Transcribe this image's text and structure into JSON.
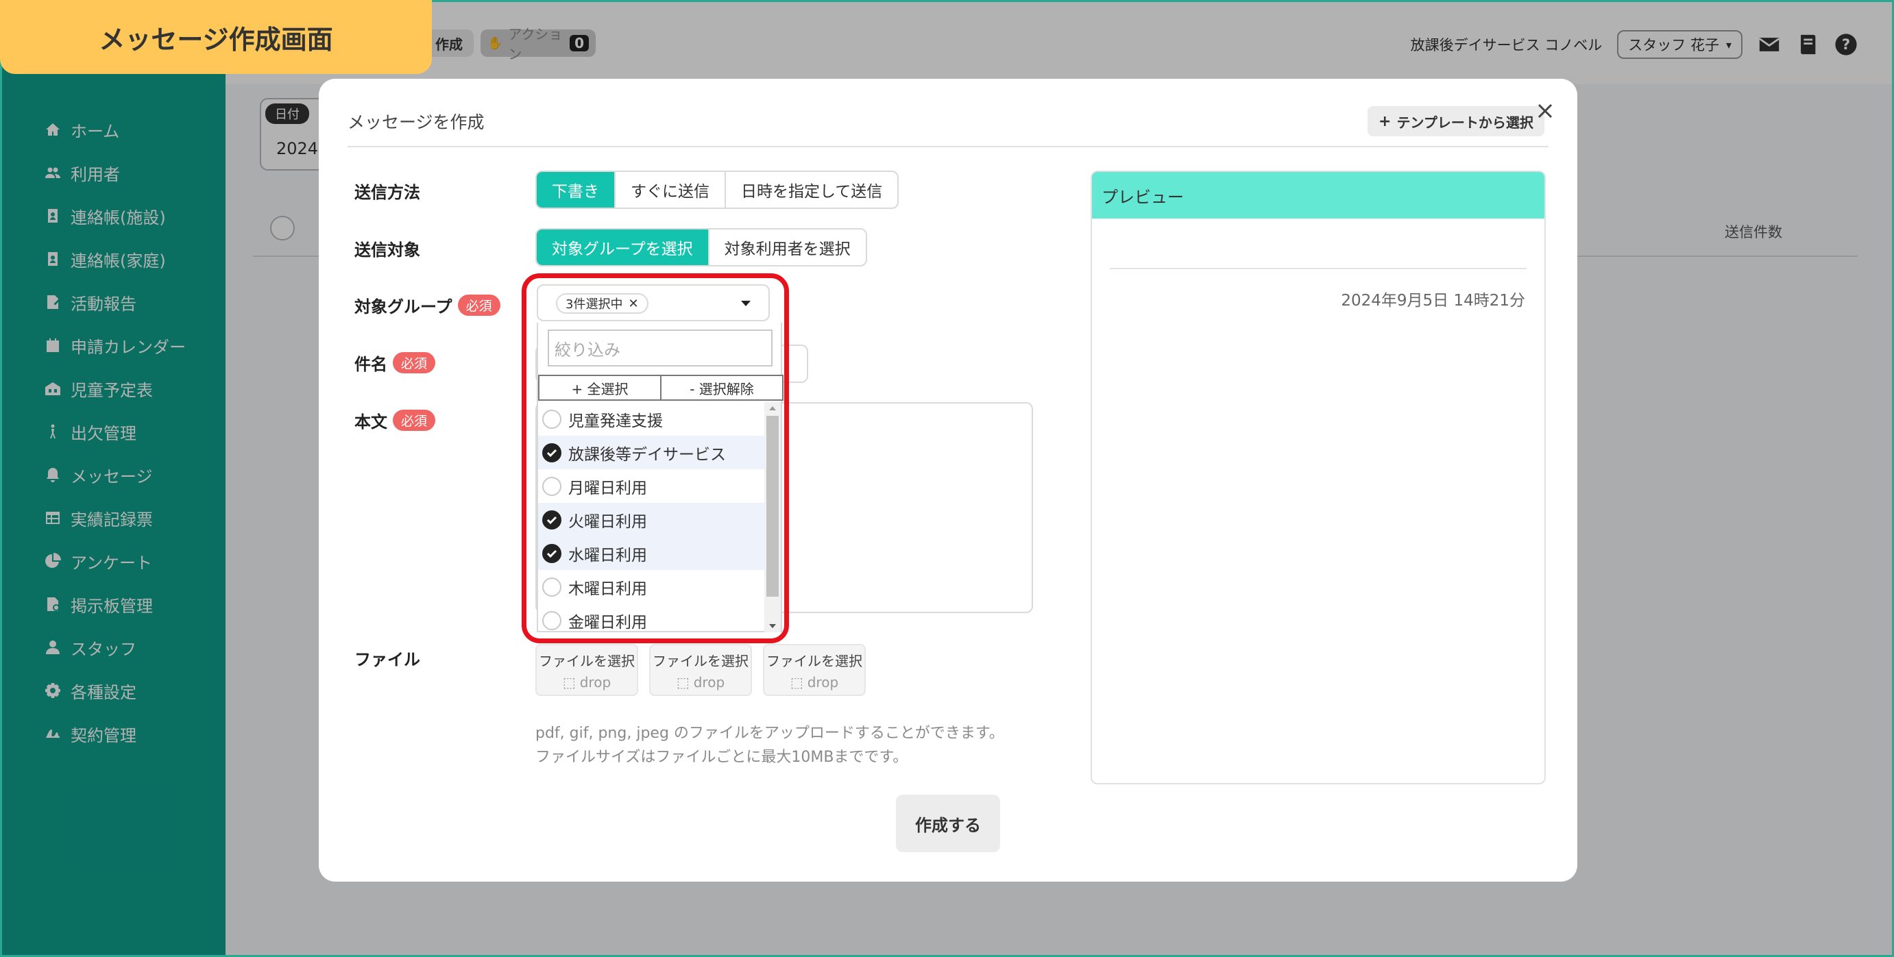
{
  "banner": {
    "title": "メッセージ作成画面"
  },
  "sidebar": {
    "items": [
      {
        "label": "ホーム",
        "icon": "home-icon"
      },
      {
        "label": "利用者",
        "icon": "users-icon"
      },
      {
        "label": "連絡帳(施設)",
        "icon": "contact-book-icon"
      },
      {
        "label": "連絡帳(家庭)",
        "icon": "contact-book-icon"
      },
      {
        "label": "活動報告",
        "icon": "report-icon"
      },
      {
        "label": "申請カレンダー",
        "icon": "calendar-icon"
      },
      {
        "label": "児童予定表",
        "icon": "schedule-icon"
      },
      {
        "label": "出欠管理",
        "icon": "attendance-icon"
      },
      {
        "label": "メッセージ",
        "icon": "bell-icon"
      },
      {
        "label": "実績記録票",
        "icon": "table-icon"
      },
      {
        "label": "アンケート",
        "icon": "pie-chart-icon"
      },
      {
        "label": "掲示板管理",
        "icon": "board-icon"
      },
      {
        "label": "スタッフ",
        "icon": "staff-icon"
      },
      {
        "label": "各種設定",
        "icon": "gear-icon"
      },
      {
        "label": "契約管理",
        "icon": "contract-icon"
      }
    ]
  },
  "header": {
    "create_chip": "作成",
    "action_chip": "アクション",
    "action_count": "0",
    "facility": "放課後デイサービス コノベル",
    "staff": "スタッフ 花子"
  },
  "page": {
    "date_tag": "日付",
    "date_value": "2024,",
    "sent_count_header": "送信件数"
  },
  "modal": {
    "title": "メッセージを作成",
    "template_button": "テンプレートから選択",
    "send_method": {
      "label": "送信方法",
      "options": [
        "下書き",
        "すぐに送信",
        "日時を指定して送信"
      ],
      "selected": "下書き"
    },
    "send_target": {
      "label": "送信対象",
      "options": [
        "対象グループを選択",
        "対象利用者を選択"
      ],
      "selected": "対象グループを選択"
    },
    "target_group": {
      "label": "対象グループ",
      "required": "必須",
      "chip": "3件選択中",
      "filter_placeholder": "絞り込み",
      "select_all": "+ 全選択",
      "deselect": "- 選択解除",
      "options": [
        {
          "label": "児童発達支援",
          "selected": false
        },
        {
          "label": "放課後等デイサービス",
          "selected": true
        },
        {
          "label": "月曜日利用",
          "selected": false
        },
        {
          "label": "火曜日利用",
          "selected": true
        },
        {
          "label": "水曜日利用",
          "selected": true
        },
        {
          "label": "木曜日利用",
          "selected": false
        },
        {
          "label": "金曜日利用",
          "selected": false
        }
      ]
    },
    "subject": {
      "label": "件名",
      "required": "必須"
    },
    "body": {
      "label": "本文",
      "required": "必須"
    },
    "file": {
      "label": "ファイル",
      "select_label": "ファイルを選択",
      "drop_label": "drop",
      "help_line1": "pdf, gif, png, jpeg のファイルをアップロードすることができます。",
      "help_line2": "ファイルサイズはファイルごとに最大10MBまでです。"
    },
    "create_button": "作成する",
    "preview": {
      "title": "プレビュー",
      "date": "2024年9月5日 14時21分"
    }
  },
  "colors": {
    "sidebar": "#0f9e8c",
    "accent": "#14c3ad",
    "preview_header": "#62e8d3",
    "required_badge": "#f06464",
    "banner": "#ffc658",
    "highlight": "#e8121d"
  }
}
